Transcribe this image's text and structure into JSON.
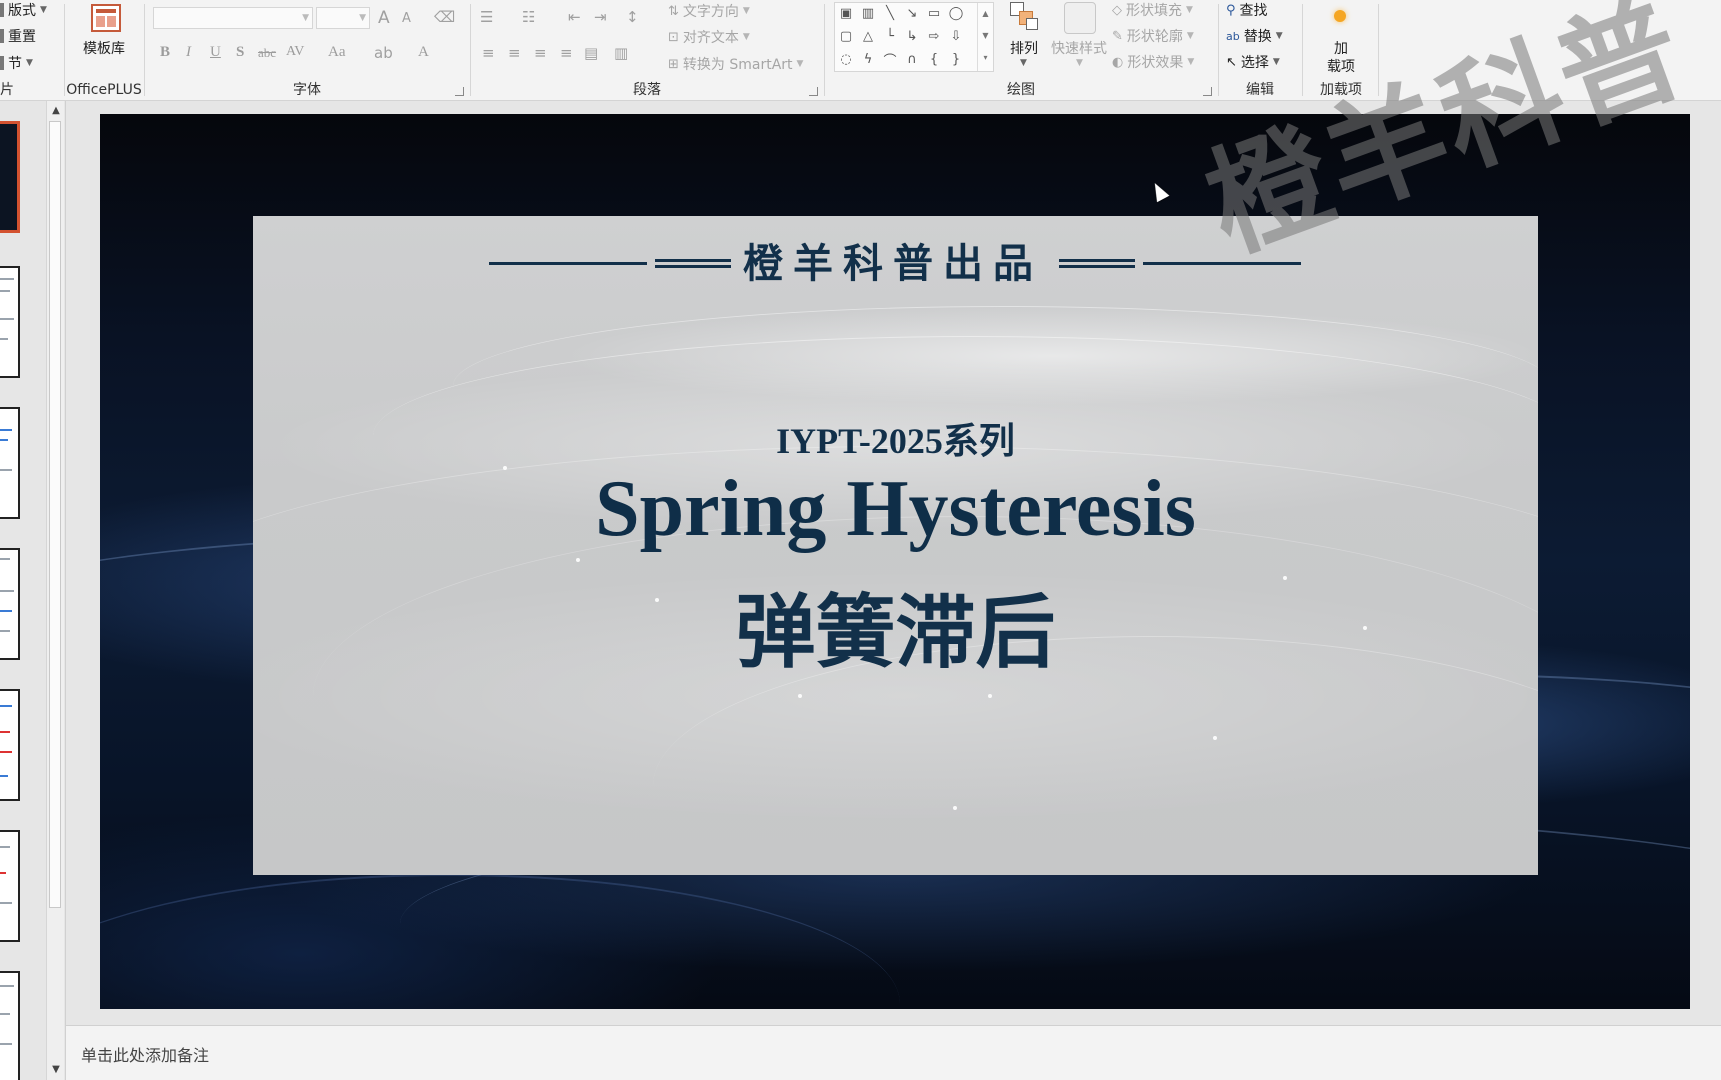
{
  "ribbon": {
    "slides_group": {
      "layout": "版式",
      "reset": "重置",
      "section": "节",
      "label_fragment": "片"
    },
    "officeplus": {
      "template_lib": "模板库",
      "label": "OfficePLUS"
    },
    "font": {
      "label": "字体",
      "bold": "B",
      "italic": "I",
      "underline": "U",
      "shadow": "S",
      "strike": "abc",
      "spacing": "AV",
      "case": "Aa",
      "grow": "A",
      "shrink": "A",
      "color": "A"
    },
    "paragraph": {
      "label": "段落",
      "text_direction": "文字方向",
      "align_text": "对齐文本",
      "smartart": "转换为 SmartArt"
    },
    "drawing": {
      "label": "绘图",
      "arrange": "排列",
      "quick_styles": "快速样式",
      "shape_fill": "形状填充",
      "shape_outline": "形状轮廓",
      "shape_effects": "形状效果"
    },
    "editing": {
      "label": "编辑",
      "find": "查找",
      "replace": "替换",
      "select": "选择"
    },
    "addins": {
      "label": "加载项",
      "button_line1": "加",
      "button_line2": "载项"
    }
  },
  "slide": {
    "brand": "橙羊科普出品",
    "series": "IYPT-2025系列",
    "title_en": "Spring Hysteresis",
    "title_cn": "弹簧滞后"
  },
  "watermark": "橙羊科普",
  "notes": {
    "placeholder": "单击此处添加备注"
  },
  "colors": {
    "accent_active_thumb": "#d35230",
    "title_color": "#12304a",
    "addin_dot": "#f5a623"
  }
}
